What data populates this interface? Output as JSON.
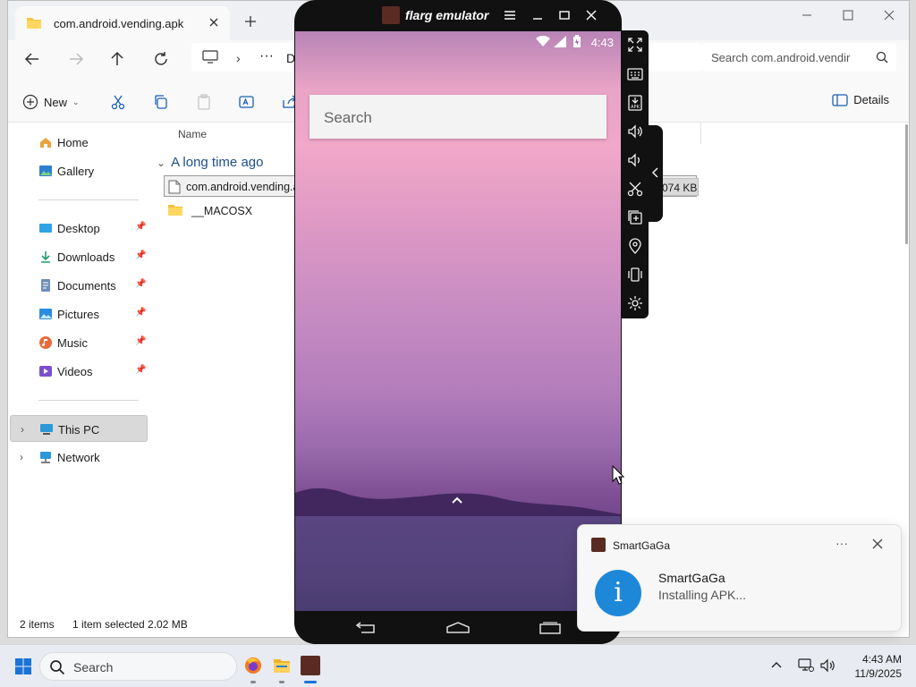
{
  "explorer": {
    "tab_title": "com.android.vending.apk",
    "breadcrumb_fragment": "Do",
    "search_placeholder": "Search com.android.vendir",
    "toolbar": {
      "new_label": "New",
      "details_label": "Details"
    },
    "sidebar": {
      "quick": [
        {
          "label": "Home",
          "icon": "home-icon"
        },
        {
          "label": "Gallery",
          "icon": "gallery-icon"
        }
      ],
      "pinned": [
        {
          "label": "Desktop",
          "icon": "desktop-icon"
        },
        {
          "label": "Downloads",
          "icon": "downloads-icon"
        },
        {
          "label": "Documents",
          "icon": "documents-icon"
        },
        {
          "label": "Pictures",
          "icon": "pictures-icon"
        },
        {
          "label": "Music",
          "icon": "music-icon"
        },
        {
          "label": "Videos",
          "icon": "videos-icon"
        }
      ],
      "tree": [
        {
          "label": "This PC",
          "icon": "this-pc-icon",
          "selected": true
        },
        {
          "label": "Network",
          "icon": "network-icon"
        }
      ]
    },
    "filelist": {
      "column_name": "Name",
      "group_header": "A long time ago",
      "files": [
        {
          "name": "com.android.vending.a",
          "size": "074 KB",
          "selected": true,
          "icon": "file-icon"
        },
        {
          "name": "__MACOSX",
          "selected": false,
          "icon": "folder-icon"
        }
      ]
    },
    "status": {
      "count": "2 items",
      "selection": "1 item selected  2.02 MB"
    }
  },
  "emulator": {
    "title": "flarg emulator",
    "android_time": "4:43",
    "search_placeholder": "Search"
  },
  "notification": {
    "app_name": "SmartGaGa",
    "more": "···",
    "title": "SmartGaGa",
    "body": "Installing APK..."
  },
  "taskbar": {
    "search_placeholder": "Search",
    "time": "4:43 AM",
    "date": "11/9/2025"
  },
  "colors": {
    "accent": "#0067c0",
    "info_blue": "#1e88d8",
    "emulator_frame": "#111111"
  }
}
